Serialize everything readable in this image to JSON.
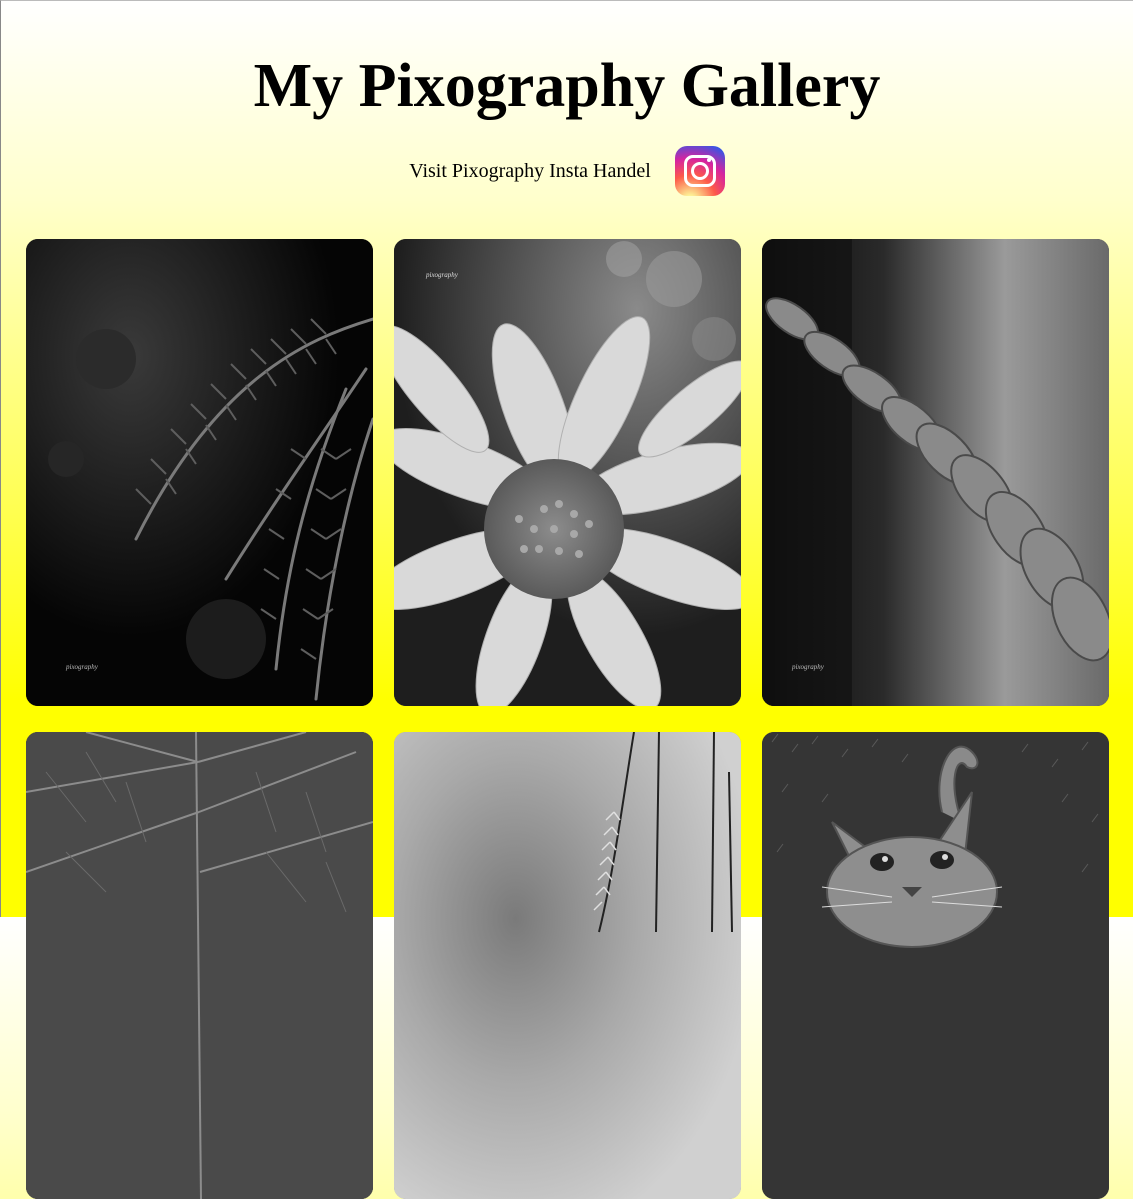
{
  "header": {
    "title": "My Pixography Gallery",
    "insta_link_text": "Visit Pixography Insta Handel",
    "insta_icon": "instagram-icon"
  },
  "gallery": {
    "photos": [
      {
        "subject": "fern-branch",
        "watermark": "pixography"
      },
      {
        "subject": "daisy-flower",
        "watermark": "pixography"
      },
      {
        "subject": "rope",
        "watermark": "pixography"
      },
      {
        "subject": "leaf",
        "watermark": ""
      },
      {
        "subject": "grass-blades",
        "watermark": ""
      },
      {
        "subject": "cat",
        "watermark": ""
      }
    ]
  }
}
